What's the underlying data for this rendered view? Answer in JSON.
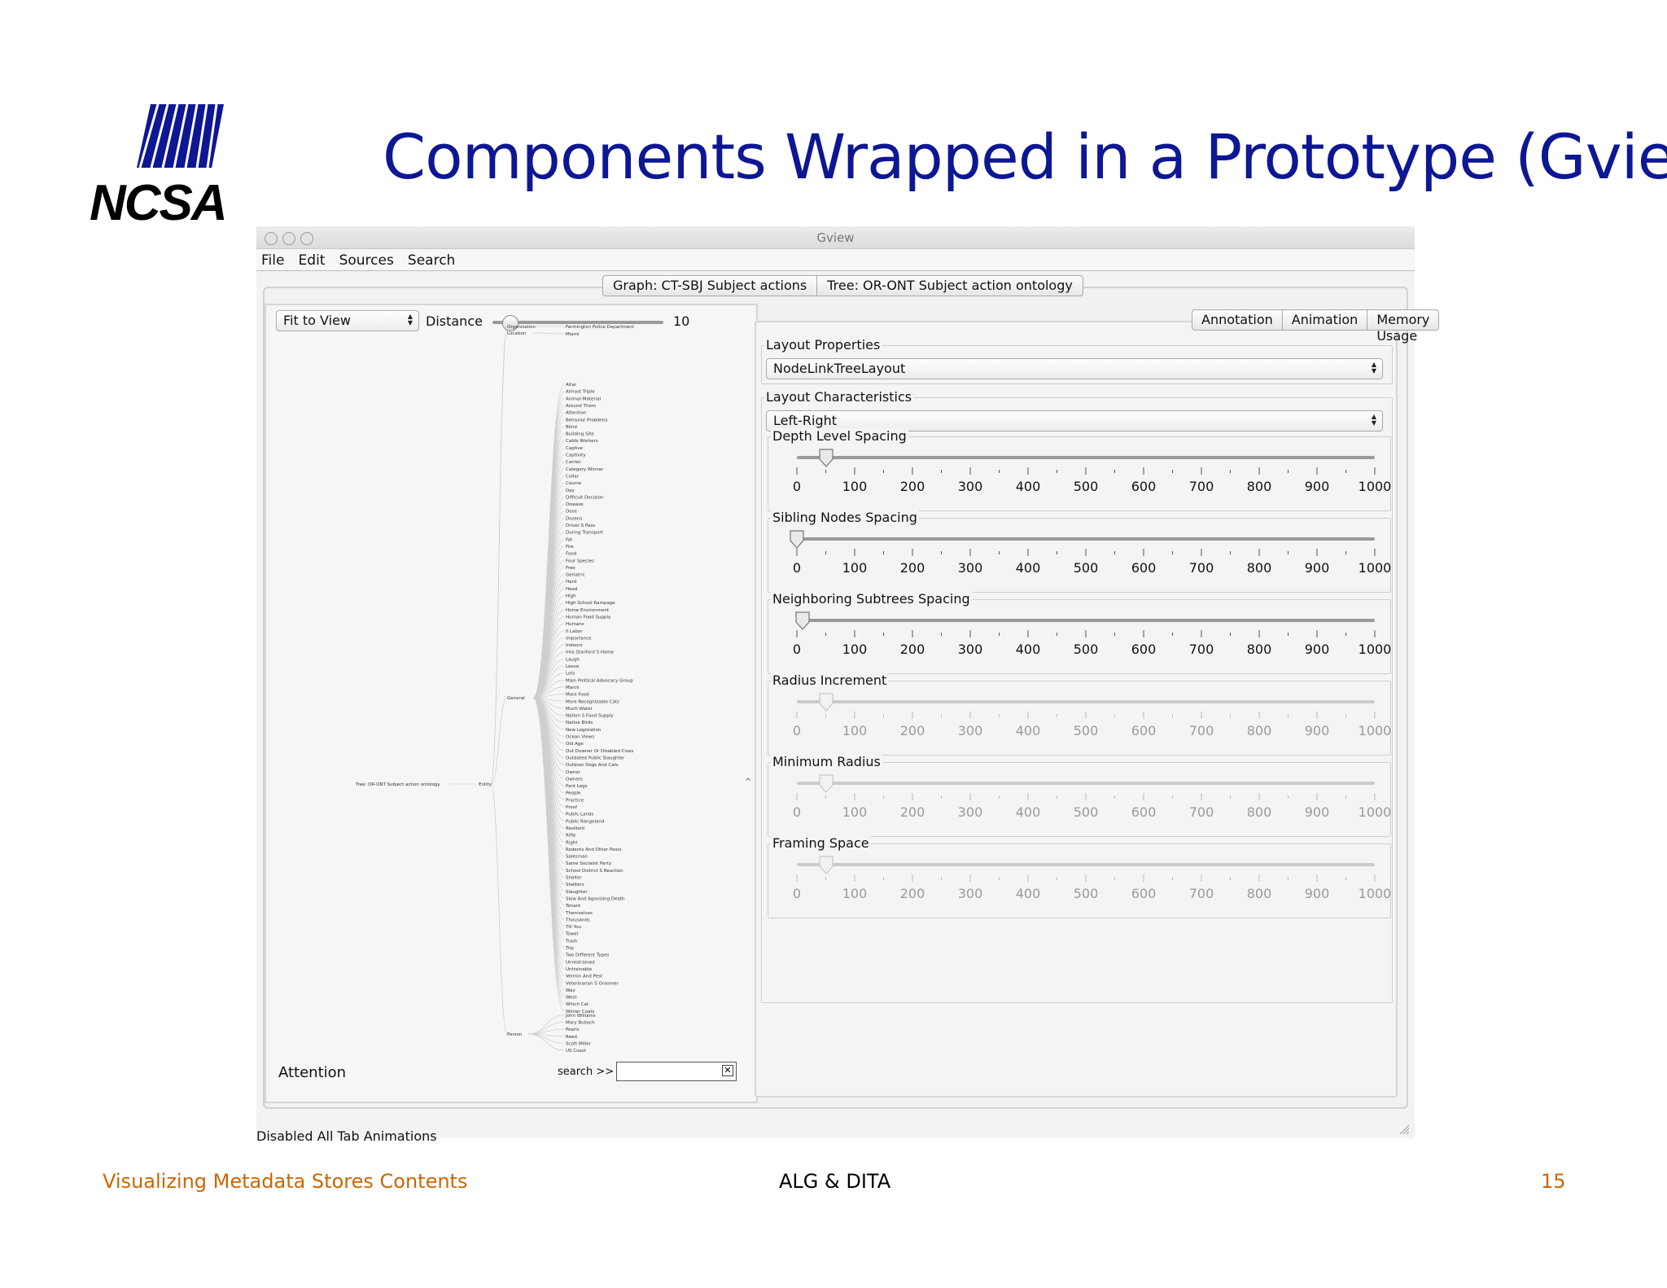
{
  "slide": {
    "title": "Components Wrapped in a Prototype (Gview)",
    "logo_text": "NCSA",
    "footer_left": "Visualizing Metadata Stores Contents",
    "footer_center": "ALG & DITA",
    "footer_right": "15",
    "footer_left_color": "#cc6600",
    "title_color": "#0d1794"
  },
  "window": {
    "title": "Gview",
    "menu": [
      "File",
      "Edit",
      "Sources",
      "Search"
    ],
    "source_tabs": [
      "Graph: CT-SBJ Subject actions",
      "Tree: OR-ONT Subject action ontology"
    ],
    "status_text": "Disabled All Tab Animations"
  },
  "left": {
    "view_select": "Fit to View",
    "distance_label": "Distance",
    "distance_value": "10",
    "attention_label": "Attention",
    "search_label": "search >>",
    "search_value": "",
    "tree": {
      "root": "Tree: OR-ONT Subject action ontology",
      "level1": "Entity",
      "level2": [
        "Organization",
        "Location",
        "General",
        "Person"
      ],
      "organization_children": [
        "Farmington Police Department"
      ],
      "location_children": [
        "Miami"
      ],
      "general_children": [
        "Altar",
        "Almost Triple",
        "Animal Material",
        "Around Them",
        "Attention",
        "Behavior Problems",
        "Blind",
        "Building Site",
        "Cable Workers",
        "Captive",
        "Captivity",
        "Carrier",
        "Category Winner",
        "Collar",
        "Course",
        "Day",
        "Difficult Decision",
        "Disease",
        "Dose",
        "Dozens",
        "Driver S Pass",
        "During Transport",
        "Fat",
        "Fire",
        "Food",
        "Four Species",
        "Free",
        "Geriatric",
        "Hard",
        "Head",
        "High",
        "High School Rampage",
        "Home Environment",
        "Human Food Supply",
        "Humans",
        "Il Labor",
        "Importance",
        "Indoors",
        "Into Stanford S Home",
        "Laugh",
        "Leave",
        "Lots",
        "Main Political Advocacy Group",
        "March",
        "More Food",
        "More Recognizable Cats",
        "Much Water",
        "Nation S Food Supply",
        "Native Birds",
        "New Legislation",
        "Ocean Views",
        "Old Age",
        "Out Downer Or Disabled Cows",
        "Outdated Public Slaughter",
        "Outdoor Dogs And Cats",
        "Owner",
        "Owners",
        "Pant Legs",
        "People",
        "Practice",
        "Proof",
        "Public Lands",
        "Public Rangeland",
        "Resilient",
        "Rifle",
        "Right",
        "Rodents And Other Pests",
        "Salesman",
        "Same Socialist Party",
        "School District S Reaction",
        "Shelter",
        "Shelters",
        "Slaughter",
        "Slow And Agonizing Death",
        "Tenant",
        "Themselves",
        "Thousands",
        "Till You",
        "Towel",
        "Trash",
        "Trip",
        "Two Different Types",
        "Unrestrained",
        "Untrainable",
        "Vermin And Pest",
        "Veterinarian S Groomer",
        "Way",
        "West",
        "Which Cat",
        "Winter Coats"
      ],
      "person_children": [
        "John Williams",
        "Mary Bulloch",
        "Pearls",
        "Reed",
        "Scott Miller",
        "US Coast"
      ]
    }
  },
  "right": {
    "tabs": [
      "Annotation",
      "Animation",
      "Memory Usage"
    ],
    "layout_properties_title": "Layout Properties",
    "layout_select": "NodeLinkTreeLayout",
    "layout_characteristics_title": "Layout Characteristics",
    "orientation_select": "Left-Right",
    "scale_labels": [
      "0",
      "100",
      "200",
      "300",
      "400",
      "500",
      "600",
      "700",
      "800",
      "900",
      "1000"
    ],
    "sliders": [
      {
        "label": "Depth Level Spacing",
        "value": 50,
        "enabled": true
      },
      {
        "label": "Sibling Nodes Spacing",
        "value": 0,
        "enabled": true
      },
      {
        "label": "Neighboring Subtrees Spacing",
        "value": 10,
        "enabled": true
      },
      {
        "label": "Radius Increment",
        "value": 50,
        "enabled": false
      },
      {
        "label": "Minimum Radius",
        "value": 50,
        "enabled": false
      },
      {
        "label": "Framing Space",
        "value": 50,
        "enabled": false
      }
    ]
  }
}
